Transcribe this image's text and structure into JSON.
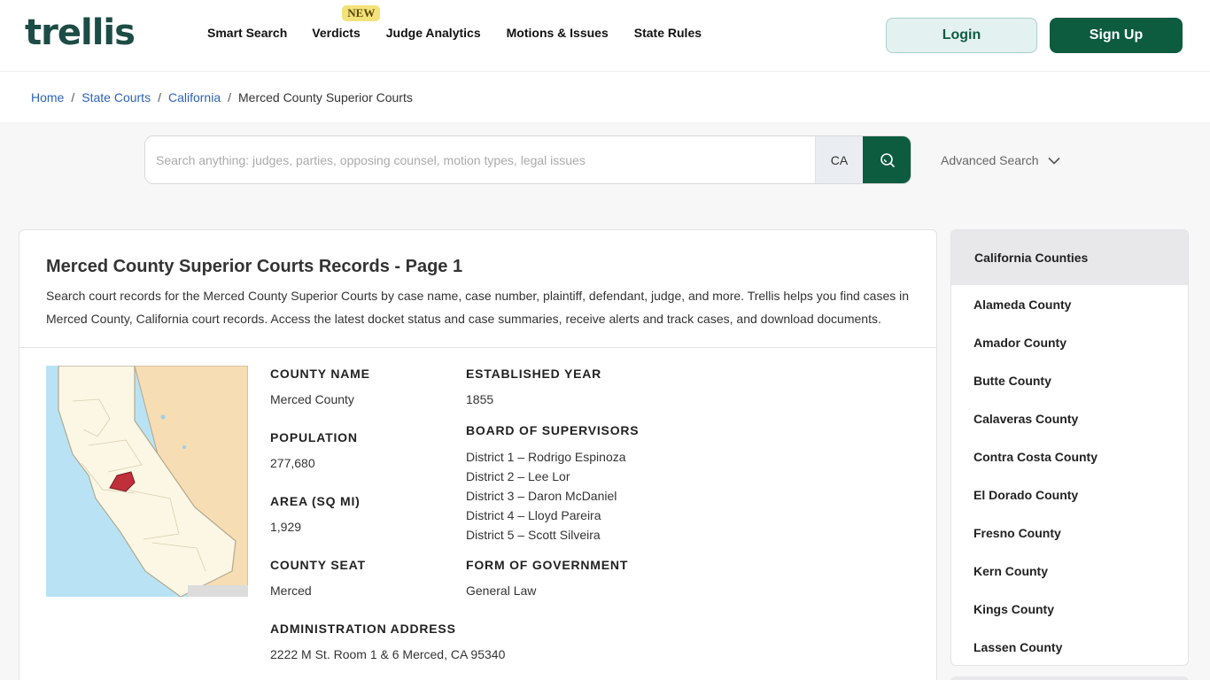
{
  "header": {
    "logo": "trellis",
    "nav": [
      {
        "label": "Smart Search"
      },
      {
        "label": "Verdicts",
        "badge": "NEW"
      },
      {
        "label": "Judge Analytics"
      },
      {
        "label": "Motions & Issues"
      },
      {
        "label": "State Rules"
      }
    ],
    "login_label": "Login",
    "signup_label": "Sign Up"
  },
  "breadcrumb": {
    "items": [
      "Home",
      "State Courts",
      "California"
    ],
    "current": "Merced County Superior Courts",
    "separator": "/"
  },
  "search": {
    "placeholder": "Search anything: judges, parties, opposing counsel, motion types, legal issues",
    "value": "",
    "state": "CA",
    "advanced_label": "Advanced Search"
  },
  "main": {
    "title": "Merced County Superior Courts Records - Page 1",
    "description": "Search court records for the Merced County Superior Courts by case name, case number, plaintiff, defendant, judge, and more. Trellis helps you find cases in Merced County, California court records. Access the latest docket status and case summaries, receive alerts and track cases, and download documents.",
    "fields": {
      "county_name": {
        "label": "COUNTY NAME",
        "value": "Merced County"
      },
      "population": {
        "label": "POPULATION",
        "value": "277,680"
      },
      "area": {
        "label": "AREA (SQ MI)",
        "value": "1,929"
      },
      "county_seat": {
        "label": "COUNTY SEAT",
        "value": "Merced"
      },
      "admin_address": {
        "label": "ADMINISTRATION ADDRESS",
        "value": "2222 M St. Room 1 & 6 Merced, CA 95340"
      },
      "established": {
        "label": "ESTABLISHED YEAR",
        "value": "1855"
      },
      "board": {
        "label": "BOARD OF SUPERVISORS",
        "members": [
          "District 1 – Rodrigo Espinoza",
          "District 2 – Lee Lor",
          "District 3 – Daron McDaniel",
          "District 4 – Lloyd Pareira",
          "District 5 – Scott Silveira"
        ]
      },
      "government": {
        "label": "FORM OF GOVERNMENT",
        "value": "General Law"
      }
    }
  },
  "sidebar": {
    "title": "California Counties",
    "counties": [
      "Alameda County",
      "Amador County",
      "Butte County",
      "Calaveras County",
      "Contra Costa County",
      "El Dorado County",
      "Fresno County",
      "Kern County",
      "Kings County",
      "Lassen County"
    ]
  },
  "colors": {
    "brand_green": "#0d5c40",
    "link_blue": "#2b63b5",
    "highlight_county": "#c0303a",
    "badge_yellow": "#f3e27b"
  }
}
